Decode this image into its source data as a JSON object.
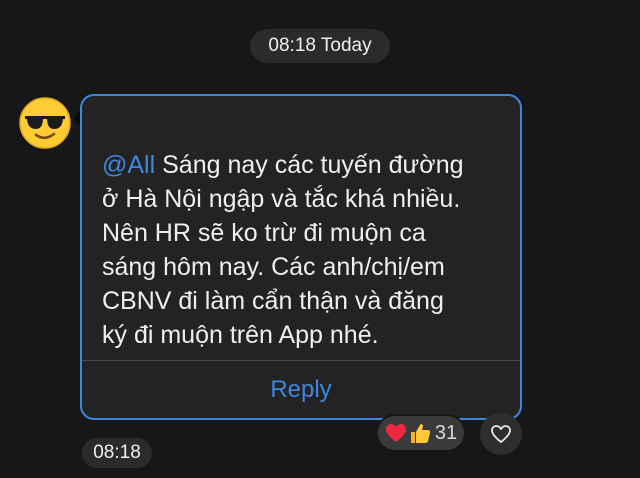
{
  "date_header": "08:18 Today",
  "message": {
    "mention": "@All",
    "lines": [
      " Sáng nay các tuyến đường",
      "ở Hà Nội ngập và tắc khá nhiều.",
      "Nên HR sẽ ko trừ đi muộn ca",
      "sáng hôm nay. Các anh/chị/em",
      "CBNV đi làm cẩn thận và đăng",
      "ký đi muộn trên App nhé."
    ],
    "reply_label": "Reply",
    "time": "08:18"
  },
  "reactions": {
    "icons": [
      "heart-icon",
      "thumbs-up-icon"
    ],
    "count": "31"
  },
  "colors": {
    "background": "#171717",
    "bubble": "#232323",
    "accent": "#3d87e0"
  }
}
